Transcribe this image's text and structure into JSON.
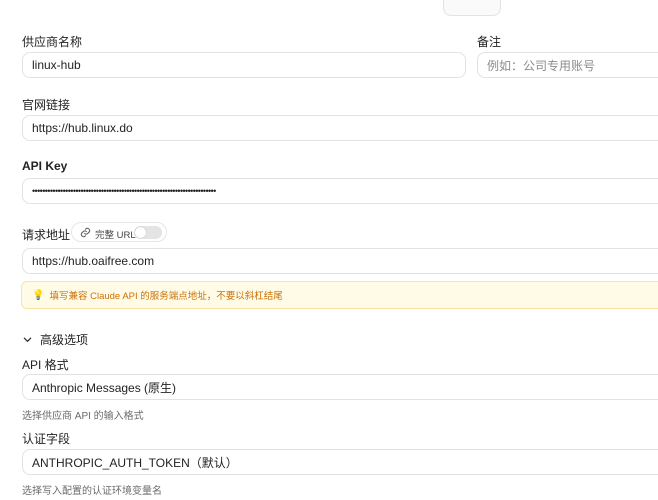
{
  "form": {
    "provider_name": {
      "label": "供应商名称",
      "value": "linux-hub"
    },
    "notes": {
      "label": "备注",
      "placeholder": "例如：公司专用账号"
    },
    "website": {
      "label": "官网链接",
      "value": "https://hub.linux.do"
    },
    "api_key": {
      "label": "API Key",
      "value": "••••••••••••••••••••••••••••••••••••••••••••••••••••••••••••••••••••••••"
    },
    "request_url": {
      "label": "请求地址",
      "full_url_label": "完整 URL",
      "full_url_enabled": false,
      "value": "https://hub.oaifree.com",
      "warning": "填写兼容 Claude API 的服务端点地址，不要以斜杠结尾"
    },
    "advanced": {
      "label": "高级选项",
      "api_format": {
        "label": "API 格式",
        "value": "Anthropic Messages (原生)",
        "help": "选择供应商 API 的输入格式"
      },
      "auth_field": {
        "label": "认证字段",
        "value": "ANTHROPIC_AUTH_TOKEN（默认）",
        "help": "选择写入配置的认证环境变量名"
      }
    }
  },
  "colors": {
    "warning_bg": "#fffbe6",
    "warning_text": "#c9730a",
    "border": "#e2e2e2"
  }
}
